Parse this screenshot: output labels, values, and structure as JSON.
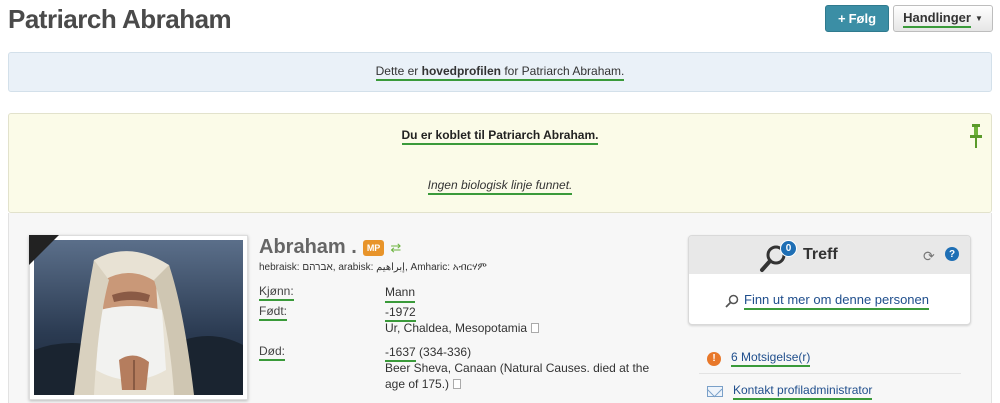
{
  "header": {
    "title": "Patriarch Abraham",
    "follow_label": "Følg",
    "follow_icon": "plus-icon",
    "actions_label": "Handlinger"
  },
  "banner": {
    "prefix": "Dette er ",
    "bold": "hovedprofilen",
    "suffix": " for Patriarch Abraham."
  },
  "connection": {
    "connected_text": "Du er koblet til Patriarch Abraham.",
    "no_line_text": "Ingen biologisk linje funnet."
  },
  "profile": {
    "name": "Abraham .",
    "badge": "MP",
    "alt_names": "hebraisk: אברהם, arabisk: إبراهيم, Amharic: አብርሃም",
    "facts": {
      "gender_label": "Kjønn:",
      "gender_value": "Mann",
      "born_label": "Født:",
      "born_year": "-1972",
      "born_place": "Ur, Chaldea, Mesopotamia",
      "death_label": "Død:",
      "death_year": "-1637",
      "death_age": " (334-336)",
      "death_place": "Beer Sheva, Canaan (Natural Causes. died at the age of 175.)"
    }
  },
  "matches": {
    "count": "0",
    "title": "Treff",
    "find_more": "Finn ut mer om denne personen"
  },
  "side": {
    "conflicts": "6 Motsigelse(r)",
    "contact": "Kontakt profiladministrator"
  },
  "colors": {
    "follow_button": "#3b8ea5",
    "banner_bg": "#eaf1f8",
    "connect_bg": "#fbfbe8",
    "badge": "#e8942a",
    "link": "#1f4e8c",
    "underline": "#3a9a3a"
  }
}
